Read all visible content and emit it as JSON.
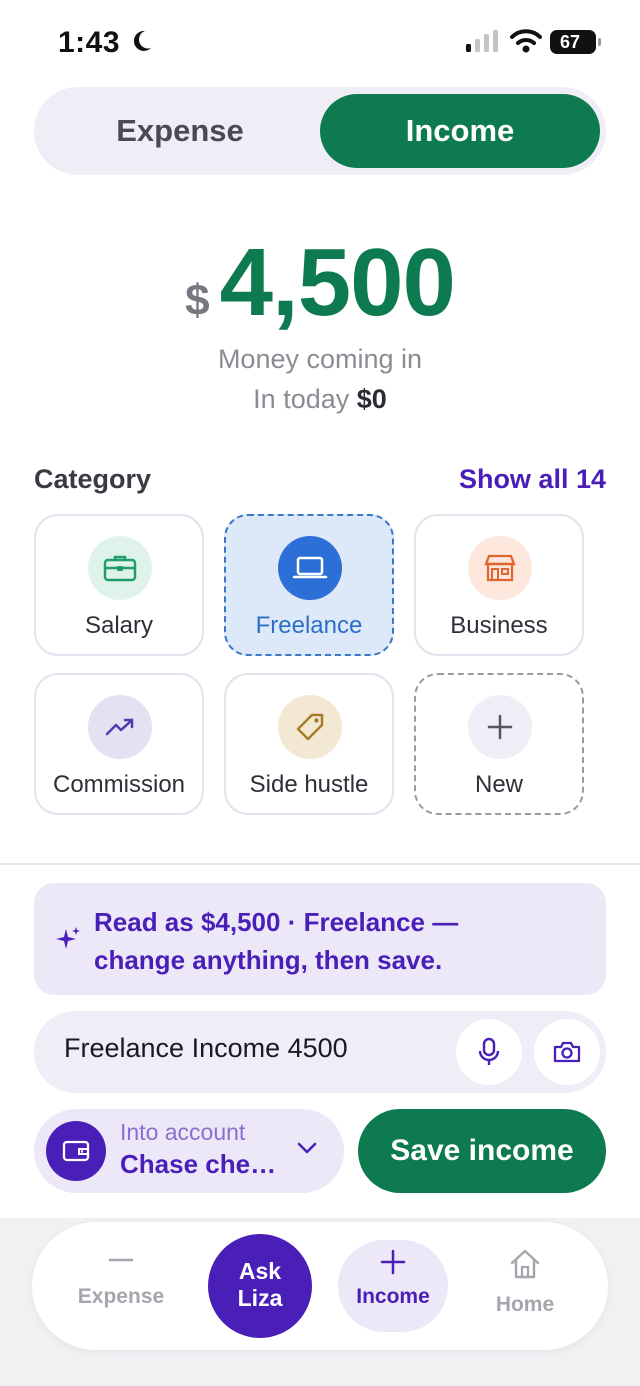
{
  "status_bar": {
    "time": "1:43",
    "battery": "67"
  },
  "toggle": {
    "expense_label": "Expense",
    "income_label": "Income",
    "selected": "Income"
  },
  "amount": {
    "currency": "$",
    "value": "4,500",
    "caption": "Money coming in",
    "today_label": "In today",
    "today_value": "$0"
  },
  "category": {
    "title": "Category",
    "show_all": "Show all 14",
    "selected": "Freelance",
    "items": [
      {
        "label": "Salary",
        "icon": "briefcase-icon",
        "color": "#1f9d6b",
        "bg": "#dff3ea"
      },
      {
        "label": "Freelance",
        "icon": "laptop-icon",
        "color": "#ffffff",
        "bg": "#2c6fd6"
      },
      {
        "label": "Business",
        "icon": "storefront-icon",
        "color": "#e0652f",
        "bg": "#fde6dc"
      },
      {
        "label": "Commission",
        "icon": "trending-up-icon",
        "color": "#4a3fb0",
        "bg": "#e4e1f3"
      },
      {
        "label": "Side hustle",
        "icon": "tag-icon",
        "color": "#a67c2b",
        "bg": "#f3e8d2"
      },
      {
        "label": "New",
        "icon": "plus-icon",
        "color": "#55555f",
        "bg": "#efedf6"
      }
    ]
  },
  "banner": {
    "line1": "Read as $4,500 · Freelance —",
    "line2": "change anything, then save."
  },
  "input": {
    "value": "Freelance Income 4500"
  },
  "account": {
    "label": "Into account",
    "value": "Chase che…"
  },
  "save_label": "Save income",
  "nav": {
    "expense": "Expense",
    "ask_line1": "Ask",
    "ask_line2": "Liza",
    "income": "Income",
    "home": "Home"
  },
  "colors": {
    "green": "#0e7a4f",
    "purple": "#4a1fb8"
  }
}
